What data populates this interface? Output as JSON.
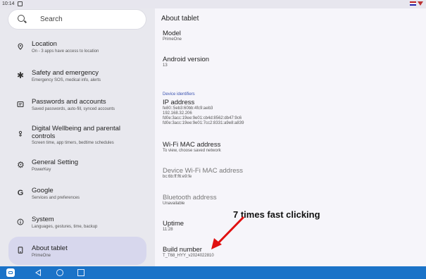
{
  "status_bar": {
    "time": "10:14"
  },
  "search": {
    "label": "Search"
  },
  "sidebar": {
    "items": [
      {
        "title": "Location",
        "subtitle": "On - 3 apps have access to location",
        "icon": "location-pin-icon"
      },
      {
        "title": "Safety and emergency",
        "subtitle": "Emergency SOS, medical info, alerts",
        "icon": "asterisk-icon"
      },
      {
        "title": "Passwords and accounts",
        "subtitle": "Saved passwords, auto-fill, synced accounts",
        "icon": "account-card-icon"
      },
      {
        "title": "Digital Wellbeing and parental controls",
        "subtitle": "Screen time, app timers, bedtime schedules",
        "icon": "wellbeing-icon"
      },
      {
        "title": "General Setting",
        "subtitle": "PowerKey",
        "icon": "gear-icon"
      },
      {
        "title": "Google",
        "subtitle": "Services and preferences",
        "icon": "google-g-icon"
      },
      {
        "title": "System",
        "subtitle": "Languages, gestures, time, backup",
        "icon": "info-icon"
      },
      {
        "title": "About tablet",
        "subtitle": "PrimeOne",
        "icon": "tablet-icon"
      }
    ]
  },
  "detail": {
    "title": "About tablet",
    "category_label": "Device identifiers",
    "prefs": [
      {
        "title": "Model",
        "summary": "PrimeOne"
      },
      {
        "title": "Android version",
        "summary": "13"
      },
      {
        "title": "IP address",
        "summary": "fe80::5eb3:60bb:4fc9:aeb3\n192.168.32.206\nfd0e:3acc:19ee:9e01:cb4d:8562:db47:9c6\nfd0e:3acc:19ee:9e01:7cc2:8331:a9e8:a839"
      },
      {
        "title": "Wi-Fi MAC address",
        "summary": "To view, choose saved network"
      },
      {
        "title": "Device Wi-Fi MAC address",
        "summary": "bc:6b:ff:f6:e9:fe"
      },
      {
        "title": "Bluetooth address",
        "summary": "Unavailable"
      },
      {
        "title": "Uptime",
        "summary": "11:28"
      },
      {
        "title": "Build number",
        "summary": "T_T68_HYY_v2024022810"
      }
    ]
  },
  "annotation": {
    "text": "7 times fast clicking",
    "color": "#e01010"
  },
  "colors": {
    "accent": "#1b73c8",
    "selected": "#d7d7ed",
    "category": "#3a52b0"
  }
}
